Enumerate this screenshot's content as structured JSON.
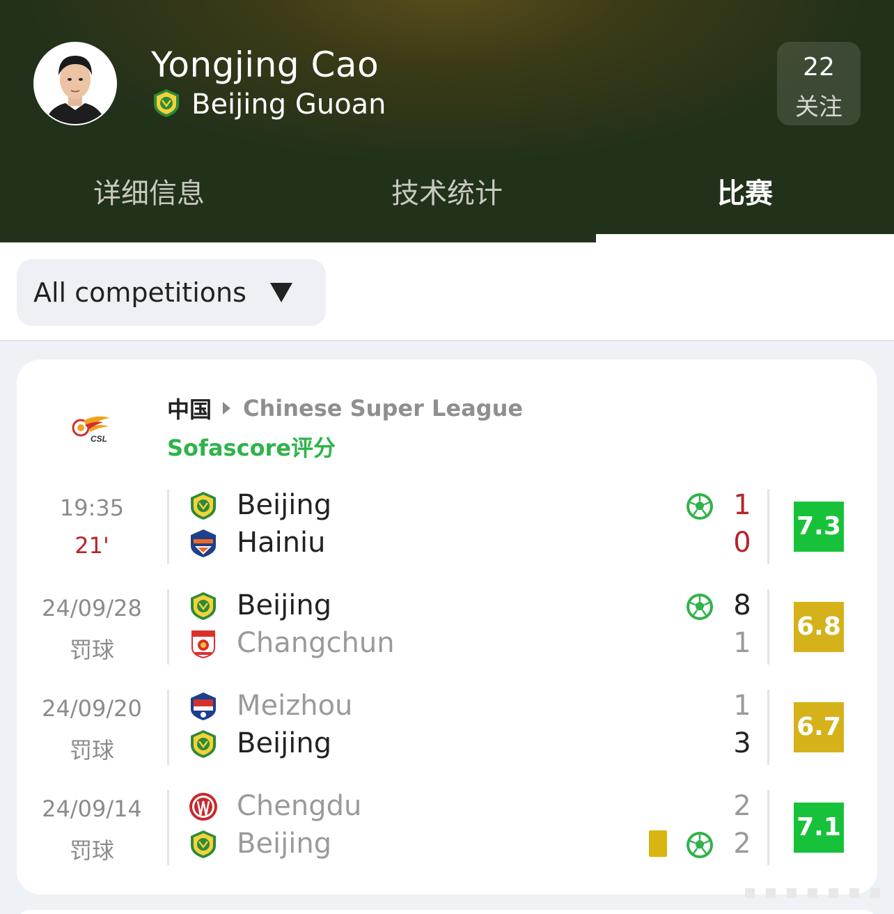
{
  "player": {
    "name": "Yongjing Cao",
    "team": "Beijing Guoan",
    "follow_count": "22",
    "follow_label": "关注"
  },
  "tabs": [
    {
      "label": "详细信息",
      "active": false
    },
    {
      "label": "技术统计",
      "active": false
    },
    {
      "label": "比赛",
      "active": true
    }
  ],
  "filter": {
    "label": "All competitions"
  },
  "competition": {
    "country": "中国",
    "league": "Chinese Super League",
    "rating_note": "Sofascore评分",
    "logo_text": "CSL"
  },
  "matches": [
    {
      "time_top": "19:35",
      "time_bottom": "21'",
      "live": true,
      "home": {
        "name": "Beijing",
        "score": "1",
        "logo": "beijing-guoan-logo"
      },
      "away": {
        "name": "Hainiu",
        "score": "0",
        "logo": "henan-logo"
      },
      "rating": "7.3"
    },
    {
      "time_top": "24/09/28",
      "time_bottom": "罚球",
      "home": {
        "name": "Beijing",
        "score": "8",
        "logo": "beijing-guoan-logo"
      },
      "away": {
        "name": "Changchun",
        "score": "1",
        "logo": "changchun-logo"
      },
      "rating": "6.8"
    },
    {
      "time_top": "24/09/20",
      "time_bottom": "罚球",
      "home": {
        "name": "Meizhou",
        "score": "1",
        "logo": "meizhou-logo"
      },
      "away": {
        "name": "Beijing",
        "score": "3",
        "logo": "beijing-guoan-logo"
      },
      "rating": "6.7"
    },
    {
      "time_top": "24/09/14",
      "time_bottom": "罚球",
      "home": {
        "name": "Chengdu",
        "score": "2",
        "logo": "chengdu-logo"
      },
      "away": {
        "name": "Beijing",
        "score": "2",
        "logo": "beijing-guoan-logo"
      },
      "rating": "7.1"
    }
  ],
  "colors": {
    "rating_green": "#17c23a",
    "rating_gold": "#d5b21a",
    "live_red": "#b3252b",
    "accent_green": "#2fb34a",
    "guoan_green": "#2e8a3a"
  }
}
